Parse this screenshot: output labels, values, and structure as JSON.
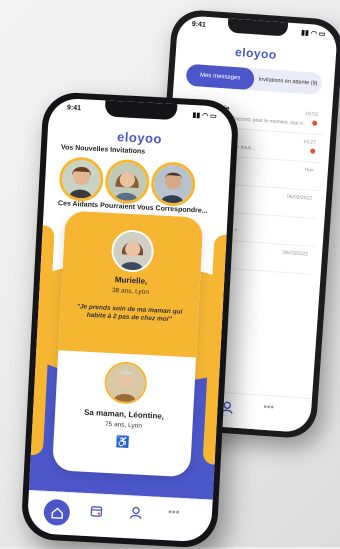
{
  "back_phone": {
    "status_time": "9:41",
    "brand": "eloyoo",
    "tabs": [
      {
        "label": "Mes messages",
        "active": true
      },
      {
        "label": "Invitations en attente (9)",
        "active": false
      }
    ],
    "messages": [
      {
        "name": "Virginie",
        "preview": "Hello Marie, d'accord, pour le moment, tout va...",
        "time": "15:52",
        "unread": true
      },
      {
        "name": "",
        "preview": "...n moment pour nous...",
        "time": "15:27",
        "unread": true
      },
      {
        "name": "",
        "preview": "...?",
        "time": "Hier",
        "unread": false
      },
      {
        "name": "",
        "preview": "",
        "time": "06/03/2022",
        "unread": false
      },
      {
        "name": "",
        "preview": "...la semaine pro ?",
        "time": "",
        "unread": false
      },
      {
        "name": "",
        "preview": "...elle de la Caf ?",
        "time": "06/03/2022",
        "unread": false
      }
    ],
    "nav_icons": [
      "person-icon",
      "more-icon"
    ]
  },
  "front_phone": {
    "status_time": "9:41",
    "brand": "eloyoo",
    "invitations_title": "Vos Nouvelles Invitations",
    "matches_title": "Ces Aidants Pourraient Vous Correspondre...",
    "card": {
      "name": "Murielle,",
      "age_city": "38 ans, Lyon",
      "quote": "\"Je prends soin de ma maman qui habite à 2 pas de chez moi\"",
      "relative_name": "Sa maman, Léontine,",
      "relative_age_city": "75 ans, Lyon",
      "mobility_icon": "wheelchair-icon"
    },
    "nav_icons": [
      "home-icon",
      "calendar-icon",
      "person-icon",
      "more-icon"
    ]
  },
  "colors": {
    "accent_blue": "#4b57c9",
    "accent_yellow": "#f6b632",
    "alert_red": "#e2522d"
  }
}
